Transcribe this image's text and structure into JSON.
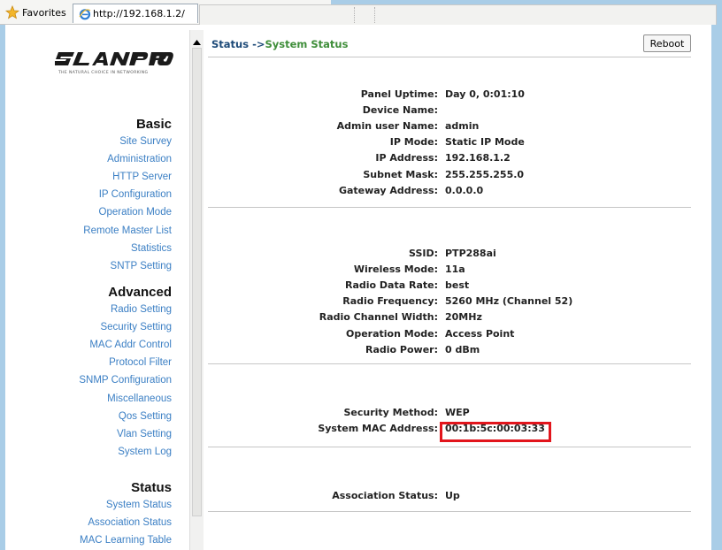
{
  "browser": {
    "favorites_label": "Favorites",
    "tab_title": "http://192.168.1.2/"
  },
  "nav": {
    "sections": [
      {
        "heading": "Basic",
        "links": [
          "Site Survey",
          "Administration",
          "HTTP Server",
          "IP Configuration",
          "Operation Mode",
          "Remote Master List",
          "Statistics",
          "SNTP Setting"
        ]
      },
      {
        "heading": "Advanced",
        "links": [
          "Radio Setting",
          "Security Setting",
          "MAC Addr Control",
          "Protocol Filter",
          "SNMP Configuration",
          "Miscellaneous",
          "Qos Setting",
          "Vlan Setting",
          "System Log"
        ]
      },
      {
        "heading": "Status",
        "links": [
          "System Status",
          "Association Status",
          "MAC Learning Table"
        ]
      }
    ]
  },
  "main": {
    "breadcrumb_parent": "Status ->",
    "breadcrumb_current": "System Status",
    "reboot_label": "Reboot",
    "system": [
      {
        "label": "Panel Uptime:",
        "value": "Day 0, 0:01:10"
      },
      {
        "label": "Device Name:",
        "value": ""
      },
      {
        "label": "Admin user Name:",
        "value": "admin"
      },
      {
        "label": "IP Mode:",
        "value": "Static IP Mode"
      },
      {
        "label": "IP Address:",
        "value": "192.168.1.2"
      },
      {
        "label": "Subnet Mask:",
        "value": "255.255.255.0"
      },
      {
        "label": "Gateway Address:",
        "value": "0.0.0.0"
      }
    ],
    "wireless": [
      {
        "label": "SSID:",
        "value": "PTP288ai"
      },
      {
        "label": "Wireless Mode:",
        "value": "11a"
      },
      {
        "label": "Radio Data Rate:",
        "value": "best"
      },
      {
        "label": "Radio Frequency:",
        "value": "5260 MHz (Channel 52)"
      },
      {
        "label": "Radio Channel Width:",
        "value": "20MHz"
      },
      {
        "label": "Operation Mode:",
        "value": "Access Point"
      },
      {
        "label": "Radio Power:",
        "value": "0 dBm"
      }
    ],
    "security": [
      {
        "label": "Security Method:",
        "value": "WEP"
      },
      {
        "label": "System MAC Address:",
        "value": "00:1b:5c:00:03:33"
      }
    ],
    "association": [
      {
        "label": "Association Status:",
        "value": "Up"
      }
    ]
  },
  "colors": {
    "nav_link": "#3b7fc4",
    "breadcrumb_current": "#3f8e3a",
    "highlight": "#e2151c",
    "frame": "#a9cde7"
  }
}
